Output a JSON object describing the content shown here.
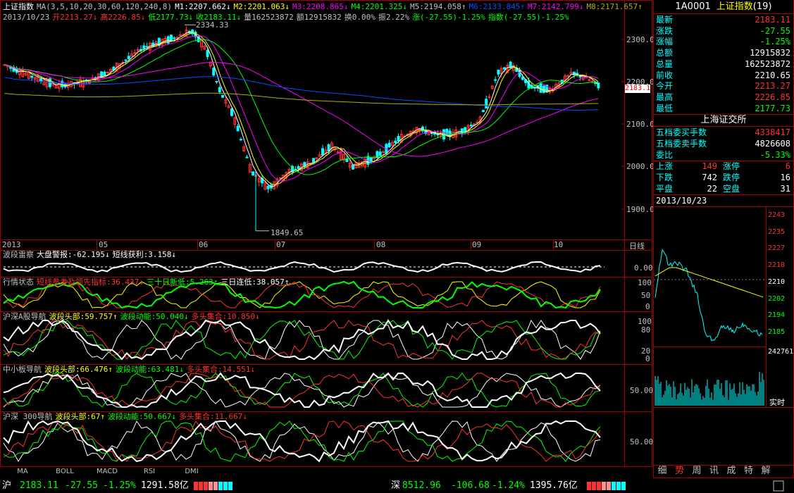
{
  "main_header": {
    "index_name": "上证指数",
    "ma_params": "MA(3,5,10,20,30,60,120,240,8)",
    "m1": "M1:2207.662↓",
    "m2": "M2:2201.063↓",
    "m3": "M3:2208.865↓",
    "m4": "M4:2201.325↓",
    "m5": "M5:2194.058↑",
    "m6": "M6:2133.845↑",
    "m7": "M7:2142.799↓",
    "m8": "M8:2171.657↑"
  },
  "ohlc_header": {
    "date": "2013/10/23",
    "open": "开2213.27↓",
    "high": "高2226.85↓",
    "low": "低2177.73↓",
    "close": "收2183.11↓",
    "volume": "量162523872",
    "amount": "额12915832",
    "turnover": "换0.00%",
    "amplitude": "振2.22%",
    "change": "涨(-27.55)-1.25%",
    "index_change": "指数(-27.55)-1.25%"
  },
  "chart_annotations": {
    "high_label": "2334.33",
    "low_label": "1849.65",
    "current_price_tag": "2183.1"
  },
  "price_axis": [
    "2300.0",
    "2200.0",
    "2100.0",
    "2000.0",
    "1900.0"
  ],
  "month_axis": [
    "2013",
    "05",
    "06",
    "07",
    "08",
    "09",
    "10"
  ],
  "period_label": "日线",
  "colors": {
    "up": "#ff3232",
    "down": "#00ffff",
    "border": "#a00000",
    "ma_white": "#ffffff",
    "ma_yellow": "#ffff00",
    "ma_magenta": "#ff00ff",
    "ma_green": "#00ff00",
    "ma_blue": "#0050ff",
    "ma_olive": "#b0b000"
  },
  "chart_data": {
    "type": "candlestick",
    "x_range": [
      "2013-01",
      "2013-10-23"
    ],
    "ylim": [
      1849.65,
      2334.33
    ],
    "key_points": [
      {
        "label": "high",
        "value": 2334.33
      },
      {
        "label": "low",
        "value": 1849.65
      },
      {
        "label": "last",
        "value": 2183.11
      }
    ]
  },
  "indicators": {
    "p1": {
      "name": "波段雷察",
      "a": "大盘警报:-62.195↓",
      "b": "短线获利:3.158↓",
      "axis": [
        "0.00"
      ]
    },
    "p2": {
      "name": "行情状态",
      "a": "短线参考及领先指标:36.437↓",
      "b": "三十日新低:5.263↑",
      "c": "三日连低:38.057↑",
      "axis": [
        "100",
        "50",
        "0"
      ]
    },
    "p3": {
      "name": "沪深A股导航",
      "a": "波段头部:59.757↑",
      "b": "波段动能:50.040↓",
      "c": "多头集合:10.850↓",
      "axis": [
        "100",
        "80",
        "20",
        "0"
      ]
    },
    "p4": {
      "name": "中小板导航",
      "a": "波段头部:66.476↑",
      "b": "波段动能:63.481↓",
      "c": "多头集合:14.551↓",
      "axis": [
        "50.00"
      ]
    },
    "p5": {
      "name": "沪深 300导航",
      "a": "波段头部:67↑",
      "b": "波段动能:50.667↓",
      "c": "多头集合:11.667↓",
      "axis": [
        "50.00"
      ]
    }
  },
  "bottom_tabs": [
    "MA",
    "BOLL",
    "MACD",
    "RSI",
    "DMI"
  ],
  "right_panel": {
    "code": "1A0001",
    "name": "上证指数",
    "count": "(19)",
    "quotes": [
      {
        "k": "最新",
        "v": "2183.11",
        "c": "#ff3232"
      },
      {
        "k": "涨跌",
        "v": "-27.55",
        "c": "#00ff00"
      },
      {
        "k": "涨幅",
        "v": "-1.25%",
        "c": "#00ff00"
      },
      {
        "k": "总额",
        "v": "12915832",
        "c": "#ffffff"
      },
      {
        "k": "总量",
        "v": "162523872",
        "c": "#ffffff"
      },
      {
        "k": "前收",
        "v": "2210.65",
        "c": "#ffffff"
      },
      {
        "k": "今开",
        "v": "2213.27",
        "c": "#ff3232"
      },
      {
        "k": "最高",
        "v": "2226.85",
        "c": "#ff3232"
      },
      {
        "k": "最低",
        "v": "2177.73",
        "c": "#00ff00"
      }
    ],
    "exchange": "上海证交所",
    "orders": [
      {
        "k": "五档委买手数",
        "v": "4338417",
        "c": "#ff3232"
      },
      {
        "k": "五档委卖手数",
        "v": "4826608",
        "c": "#ffffff"
      },
      {
        "k": "委比",
        "v": "-5.33%",
        "c": "#00ff00"
      }
    ],
    "breadth": [
      {
        "k1": "上涨",
        "v1": "149",
        "c1": "#ff3232",
        "k2": "涨停",
        "v2": "6",
        "c2": "#ff3232"
      },
      {
        "k1": "下跌",
        "v1": "742",
        "c1": "#ffffff",
        "k2": "跌停",
        "v2": "16",
        "c2": "#ffffff"
      },
      {
        "k1": "平盘",
        "v1": "22",
        "c1": "#ffffff",
        "k2": "空盘",
        "v2": "31",
        "c2": "#ffffff"
      }
    ],
    "intraday_date": "2013/10/23",
    "intraday_axis": [
      "2243",
      "2235",
      "2227",
      "2218",
      "2210",
      "2202",
      "2194",
      "2185"
    ],
    "intraday_volume_max": "242761",
    "realtime_label": "实时",
    "tabs": [
      "细",
      "势",
      "周",
      "讯",
      "成",
      "特",
      "解"
    ]
  },
  "status_bar": {
    "sh_prefix": "沪",
    "sh_price": "2183.11",
    "sh_change": "-27.55",
    "sh_pct": "-1.25%",
    "sh_amount": "1291.58亿",
    "sz_prefix": "深",
    "sz_price": "8512.96",
    "sz_change": "-106.68",
    "sz_pct": "-1.24%",
    "sz_amount": "1395.76亿"
  }
}
